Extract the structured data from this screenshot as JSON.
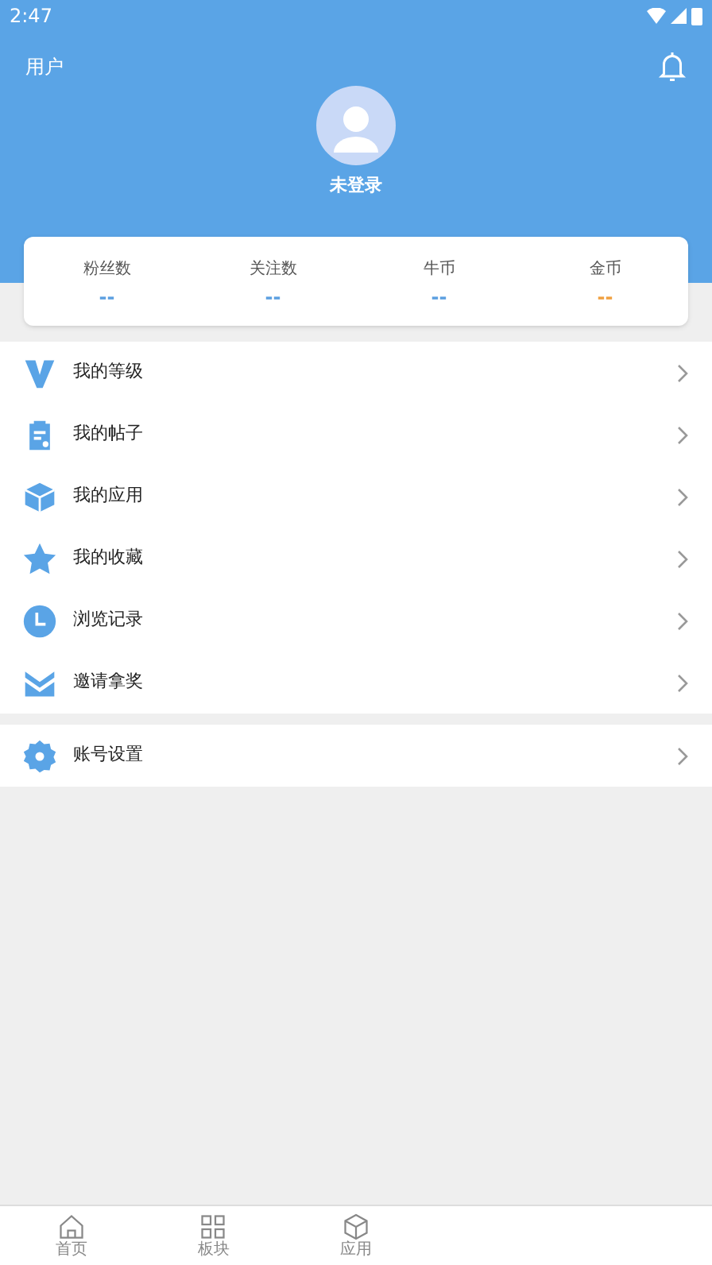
{
  "status_bar": {
    "time": "2:47"
  },
  "header": {
    "title": "用户",
    "username": "未登录"
  },
  "stats": [
    {
      "label": "粉丝数",
      "value": "--",
      "color": "#5b9fe0"
    },
    {
      "label": "关注数",
      "value": "--",
      "color": "#5b9fe0"
    },
    {
      "label": "牛币",
      "value": "--",
      "color": "#5b9fe0"
    },
    {
      "label": "金币",
      "value": "--",
      "color": "#f0a040"
    }
  ],
  "menu_groups": [
    [
      {
        "kind": "level",
        "label": "我的等级"
      },
      {
        "kind": "posts",
        "label": "我的帖子"
      },
      {
        "kind": "apps",
        "label": "我的应用"
      },
      {
        "kind": "favorites",
        "label": "我的收藏"
      },
      {
        "kind": "history",
        "label": "浏览记录"
      },
      {
        "kind": "invite",
        "label": "邀请拿奖"
      }
    ],
    [
      {
        "kind": "settings",
        "label": "账号设置"
      }
    ]
  ],
  "bottom_nav": [
    {
      "kind": "home",
      "label": "首页",
      "selected": false
    },
    {
      "kind": "boards",
      "label": "板块",
      "selected": false
    },
    {
      "kind": "apps",
      "label": "应用",
      "selected": false
    }
  ]
}
